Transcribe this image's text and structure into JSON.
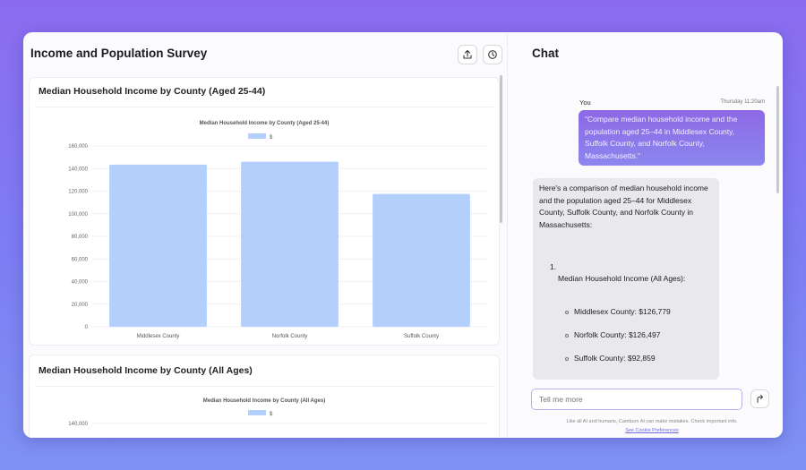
{
  "app_title": "Income and Population Survey",
  "toolbar": {
    "share_icon": "upload-icon",
    "history_icon": "history-icon"
  },
  "cards": [
    {
      "title": "Median Household Income by County (Aged 25-44)",
      "chart_data": {
        "type": "bar",
        "title": "Median Household Income by County (Aged 25-44)",
        "legend": [
          "$"
        ],
        "legend_position": "top-center",
        "categories": [
          "Middlesex County",
          "Norfolk County",
          "Suffolk County"
        ],
        "series": [
          {
            "name": "$",
            "values": [
              143500,
              146000,
              117500
            ]
          }
        ],
        "ylim": [
          0,
          160000
        ],
        "yticks": [
          "160,000",
          "140,000",
          "120,000",
          "100,000",
          "80,000",
          "60,000",
          "40,000",
          "20,000",
          "0"
        ],
        "grid": true,
        "color": "#b3cffb"
      }
    },
    {
      "title": "Median Household Income by County (All Ages)",
      "chart_data": {
        "type": "bar",
        "title": "Median Household Income by County (All Ages)",
        "legend": [
          "$"
        ],
        "legend_position": "top-center",
        "yticks": [
          "140,000"
        ],
        "color": "#b3cffb"
      }
    }
  ],
  "chat": {
    "title": "Chat",
    "user_message": {
      "sender": "You",
      "timestamp": "Thursday 11:20am",
      "text": "\"Compare median household income and the population aged 25–44 in Middlesex County, Suffolk County, and Norfolk County, Massachusetts.\""
    },
    "ai_message": {
      "intro": "Here's a comparison of median household income and the population aged 25–44 for Middlesex County, Suffolk County, and Norfolk County in Massachusetts:",
      "list_number": "1.",
      "section_heading": "Median Household Income (All Ages):",
      "bullets": [
        "Middlesex County: $126,779",
        "Norfolk County: $126,497",
        "Suffolk County: $92,859"
      ]
    },
    "input_placeholder": "Tell me more",
    "send_icon": "send-arrow-icon",
    "disclaimer": "Like all AI and humans, Camburn AI can make mistakes. Check important info.",
    "cookie_link": "See Cookie Preferences"
  }
}
